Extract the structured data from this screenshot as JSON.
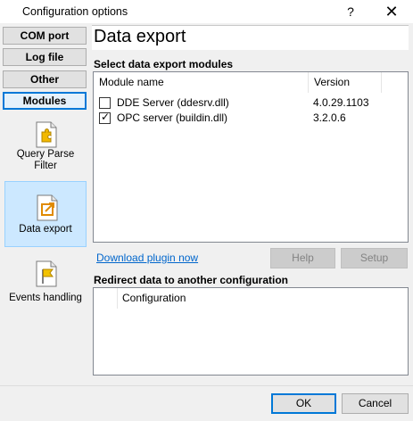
{
  "window": {
    "title": "Configuration options",
    "help_glyph": "?",
    "close_glyph": "✕"
  },
  "nav": {
    "buttons": [
      {
        "label": "COM port"
      },
      {
        "label": "Log file"
      },
      {
        "label": "Other"
      },
      {
        "label": "Modules",
        "active": true
      }
    ],
    "modules": [
      {
        "label": "Query Parse Filter",
        "icon": "puzzle-icon"
      },
      {
        "label": "Data export",
        "icon": "export-arrow-icon",
        "selected": true
      },
      {
        "label": "Events handling",
        "icon": "flag-icon"
      }
    ]
  },
  "panel": {
    "title": "Data export",
    "select_section": "Select data export modules",
    "columns": {
      "name": "Module name",
      "version": "Version"
    },
    "rows": [
      {
        "name": "DDE Server (ddesrv.dll)",
        "version": "4.0.29.1103",
        "checked": false
      },
      {
        "name": "OPC server (buildin.dll)",
        "version": "3.2.0.6",
        "checked": true
      }
    ],
    "download_link": "Download plugin now",
    "help_button": "Help",
    "setup_button": "Setup",
    "redirect_section": "Redirect data to another configuration",
    "redirect_column": "Configuration"
  },
  "footer": {
    "ok": "OK",
    "cancel": "Cancel"
  },
  "colors": {
    "accent": "#0078d7",
    "selection": "#cce8ff",
    "link": "#0066cc"
  }
}
